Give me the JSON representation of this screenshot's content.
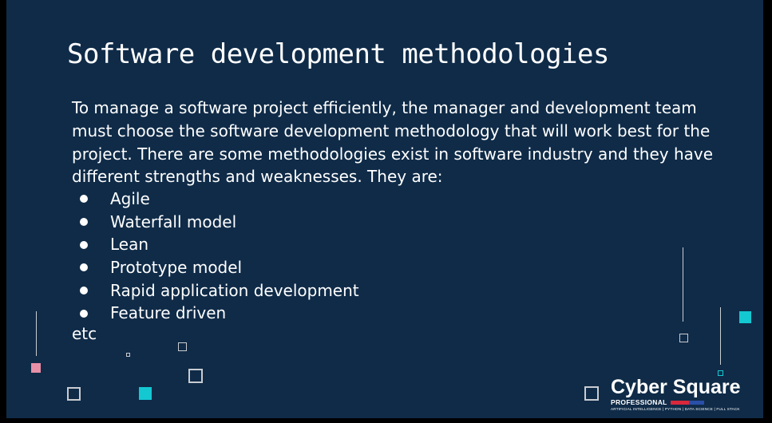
{
  "slide": {
    "title": "Software development methodologies",
    "paragraph": "To manage a software project efficiently, the manager and development team must choose the software development methodology that will work best for the project. There are some methodologies exist in software industry and they have different strengths and weaknesses. They are:",
    "methodologies": [
      "Agile",
      "Waterfall model",
      "Lean",
      "Prototype model",
      "Rapid application development",
      "Feature driven"
    ],
    "trailing_text": "etc"
  },
  "logo": {
    "name": "Cyber Square",
    "tier": "PROFESSIONAL",
    "tagline": "ARTIFICIAL INTELLIGENCE | PYTHON | DATA SCIENCE | FULL STACK"
  },
  "colors": {
    "background": "#0f2b48",
    "text": "#ffffff",
    "accent_teal": "#14c8d2",
    "accent_pink": "#e890a8"
  }
}
